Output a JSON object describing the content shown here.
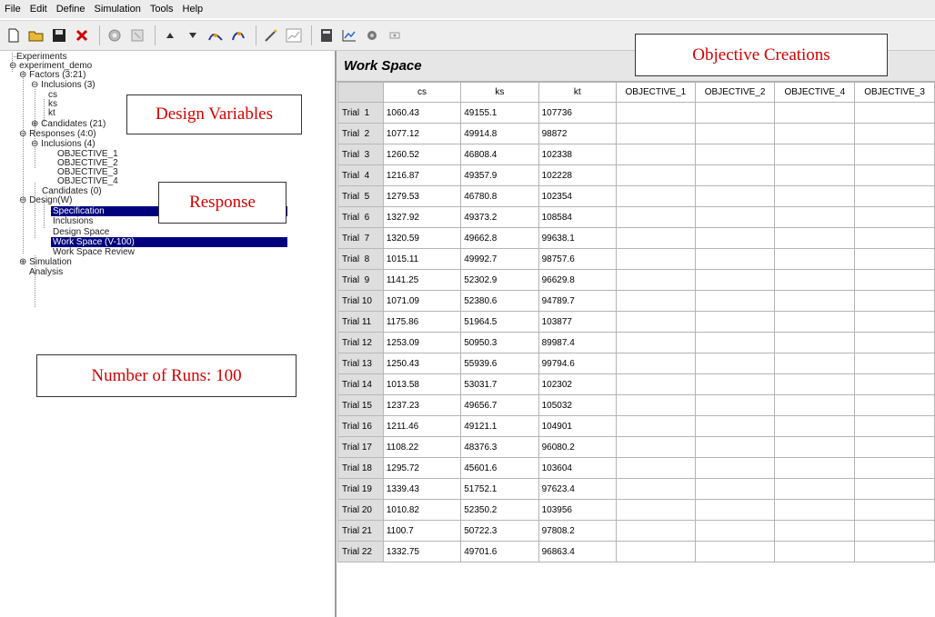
{
  "menu": [
    "File",
    "Edit",
    "Define",
    "Simulation",
    "Tools",
    "Help"
  ],
  "toolbar": {
    "buttons": [
      "new-icon",
      "open-icon",
      "save-icon",
      "delete-icon",
      "run-icon",
      "stop-icon",
      "move-up-icon",
      "move-down-icon",
      "run-analysis-icon",
      "run-design-icon",
      "wand-icon",
      "report-icon",
      "calculator-icon",
      "chart-icon",
      "record-icon",
      "filter-icon"
    ]
  },
  "tree": {
    "experiments": "Experiments",
    "experiment_demo": "experiment_demo",
    "factors": "Factors (3:21)",
    "factor_inclusions": "Inclusions (3)",
    "cs": "cs",
    "ks": "ks",
    "kt": "kt",
    "factor_candidates": "Candidates (21)",
    "responses": "Responses (4:0)",
    "response_inclusions": "Inclusions (4)",
    "obj1": "OBJECTIVE_1",
    "obj2": "OBJECTIVE_2",
    "obj3": "OBJECTIVE_3",
    "obj4": "OBJECTIVE_4",
    "response_candidates": "Candidates (0)",
    "design": "Design(W)",
    "specification": "Specification",
    "inclusions": "Inclusions",
    "design_space": "Design Space",
    "work_space": "Work Space (V-100)",
    "work_space_review": "Work Space Review",
    "simulation": "Simulation",
    "analysis": "Analysis"
  },
  "annotations": {
    "design_variables": "Design Variables",
    "response": "Response",
    "runs": "Number of Runs: 100",
    "objective_creations": "Objective Creations",
    "color": "#d40000"
  },
  "workspace": {
    "title": "Work Space",
    "columns": [
      "cs",
      "ks",
      "kt",
      "OBJECTIVE_1",
      "OBJECTIVE_2",
      "OBJECTIVE_4",
      "OBJECTIVE_3"
    ],
    "rows": [
      [
        "Trial  1",
        "1060.43",
        "49155.1",
        "107736"
      ],
      [
        "Trial  2",
        "1077.12",
        "49914.8",
        "98872"
      ],
      [
        "Trial  3",
        "1260.52",
        "46808.4",
        "102338"
      ],
      [
        "Trial  4",
        "1216.87",
        "49357.9",
        "102228"
      ],
      [
        "Trial  5",
        "1279.53",
        "46780.8",
        "102354"
      ],
      [
        "Trial  6",
        "1327.92",
        "49373.2",
        "108584"
      ],
      [
        "Trial  7",
        "1320.59",
        "49662.8",
        "99638.1"
      ],
      [
        "Trial  8",
        "1015.11",
        "49992.7",
        "98757.6"
      ],
      [
        "Trial  9",
        "1141.25",
        "52302.9",
        "96629.8"
      ],
      [
        "Trial 10",
        "1071.09",
        "52380.6",
        "94789.7"
      ],
      [
        "Trial 11",
        "1175.86",
        "51964.5",
        "103877"
      ],
      [
        "Trial 12",
        "1253.09",
        "50950.3",
        "89987.4"
      ],
      [
        "Trial 13",
        "1250.43",
        "55939.6",
        "99794.6"
      ],
      [
        "Trial 14",
        "1013.58",
        "53031.7",
        "102302"
      ],
      [
        "Trial 15",
        "1237.23",
        "49656.7",
        "105032"
      ],
      [
        "Trial 16",
        "1211.46",
        "49121.1",
        "104901"
      ],
      [
        "Trial 17",
        "1108.22",
        "48376.3",
        "96080.2"
      ],
      [
        "Trial 18",
        "1295.72",
        "45601.6",
        "103604"
      ],
      [
        "Trial 19",
        "1339.43",
        "51752.1",
        "97623.4"
      ],
      [
        "Trial 20",
        "1010.82",
        "52350.2",
        "103956"
      ],
      [
        "Trial 21",
        "1100.7",
        "50722.3",
        "97808.2"
      ],
      [
        "Trial 22",
        "1332.75",
        "49701.6",
        "96863.4"
      ]
    ]
  }
}
